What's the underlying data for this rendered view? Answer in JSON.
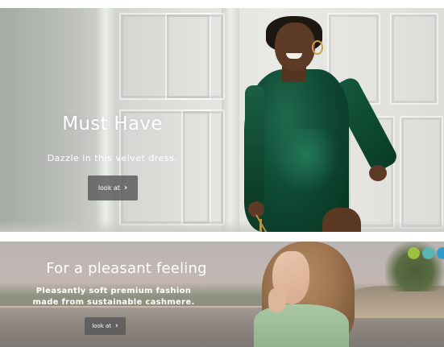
{
  "banner_must_have": {
    "title": "Must Have",
    "subtitle": "Dazzle in this velvet dress.",
    "button_label": "look at",
    "button_icon": "chevron-right-icon",
    "accent_color": "#0f4a34"
  },
  "banner_pleasant_feeling": {
    "title": "For a pleasant feeling",
    "subtitle_line1": "Pleasantly soft premium fashion",
    "subtitle_line2": "made from sustainable cashmere.",
    "button_label": "look at",
    "button_icon": "chevron-right-icon",
    "color_dots": [
      "#9cc23d",
      "#58b5b3",
      "#2e9bd0"
    ]
  }
}
